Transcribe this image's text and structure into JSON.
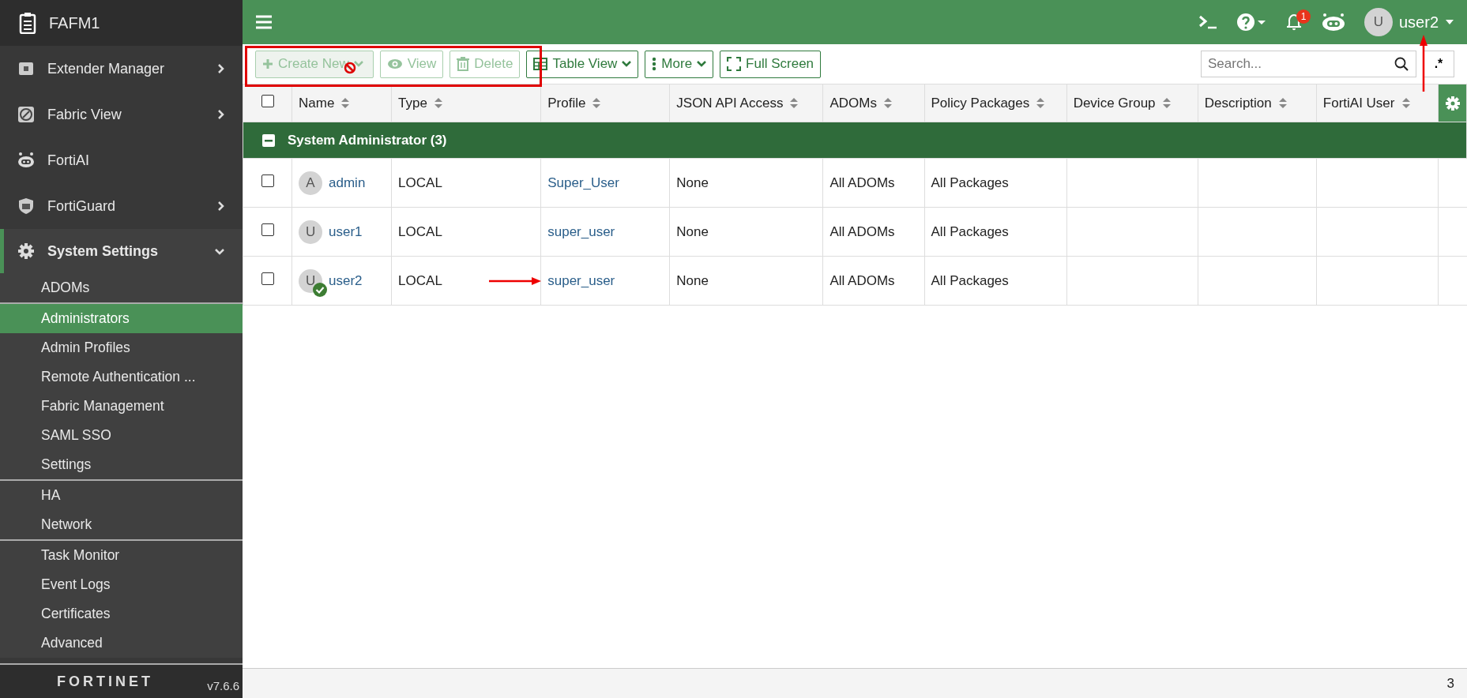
{
  "sidebar": {
    "title": "FAFM1",
    "items": [
      {
        "label": "Extender Manager",
        "expandable": true,
        "expanded": false
      },
      {
        "label": "Fabric View",
        "expandable": true,
        "expanded": false
      },
      {
        "label": "FortiAI",
        "expandable": false,
        "expanded": false
      },
      {
        "label": "FortiGuard",
        "expandable": true,
        "expanded": false
      },
      {
        "label": "System Settings",
        "expandable": true,
        "expanded": true,
        "children": [
          {
            "label": "ADOMs",
            "selected": false,
            "divider_before": false
          },
          {
            "label": "Administrators",
            "selected": true,
            "divider_before": true
          },
          {
            "label": "Admin Profiles",
            "selected": false,
            "divider_before": false
          },
          {
            "label": "Remote Authentication ...",
            "selected": false,
            "divider_before": false
          },
          {
            "label": "Fabric Management",
            "selected": false,
            "divider_before": false
          },
          {
            "label": "SAML SSO",
            "selected": false,
            "divider_before": false
          },
          {
            "label": "Settings",
            "selected": false,
            "divider_before": false
          },
          {
            "label": "HA",
            "selected": false,
            "divider_before": true
          },
          {
            "label": "Network",
            "selected": false,
            "divider_before": false
          },
          {
            "label": "Task Monitor",
            "selected": false,
            "divider_before": true
          },
          {
            "label": "Event Logs",
            "selected": false,
            "divider_before": false
          },
          {
            "label": "Certificates",
            "selected": false,
            "divider_before": false
          },
          {
            "label": "Advanced",
            "selected": false,
            "divider_before": false
          }
        ]
      }
    ],
    "logo": "FORTINET",
    "version": "v7.6.6"
  },
  "header": {
    "notification_count": "1",
    "avatar": "U",
    "user": "user2"
  },
  "toolbar": {
    "buttons": [
      {
        "label": "Create New",
        "dropdown": true,
        "disabled": true
      },
      {
        "label": "View",
        "dropdown": false,
        "disabled": true
      },
      {
        "label": "Delete",
        "dropdown": false,
        "disabled": true
      },
      {
        "label": "Table View",
        "dropdown": true,
        "disabled": false
      },
      {
        "label": "More",
        "dropdown": true,
        "disabled": false
      },
      {
        "label": "Full Screen",
        "dropdown": false,
        "disabled": false
      }
    ],
    "search": {
      "placeholder": "Search..."
    },
    "regex": ".*"
  },
  "table": {
    "select_all_checked": false,
    "columns": [
      "Name",
      "Type",
      "Profile",
      "JSON API Access",
      "ADOMs",
      "Policy Packages",
      "Device Group",
      "Description",
      "FortiAI User"
    ],
    "group": {
      "label": "System Administrator (3)",
      "expanded": true
    },
    "rows": [
      {
        "avatar": "A",
        "name": "admin",
        "logged_in": false,
        "type": "LOCAL",
        "profile": "Super_User",
        "json_api": "None",
        "adoms": "All ADOMs",
        "policy_packages": "All Packages",
        "checked": false
      },
      {
        "avatar": "U",
        "name": "user1",
        "logged_in": false,
        "type": "LOCAL",
        "profile": "super_user",
        "json_api": "None",
        "adoms": "All ADOMs",
        "policy_packages": "All Packages",
        "checked": false
      },
      {
        "avatar": "U",
        "name": "user2",
        "logged_in": true,
        "type": "LOCAL",
        "profile": "super_user",
        "json_api": "None",
        "adoms": "All ADOMs",
        "policy_packages": "All Packages",
        "checked": false
      }
    ]
  },
  "status_bar": {
    "count": "3"
  }
}
